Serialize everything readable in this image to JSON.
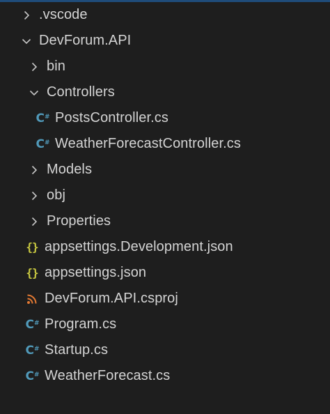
{
  "colors": {
    "background": "#1e1e1e",
    "text": "#d4d4d4",
    "chevron": "#c5c5c5",
    "csharp_icon": "#519aba",
    "json_icon": "#cbcb41",
    "csproj_icon": "#e37933",
    "top_accent": "#1f4c7a"
  },
  "tree": [
    {
      "label": ".vscode",
      "kind": "folder",
      "state": "collapsed",
      "icon": "chevron-right-icon"
    },
    {
      "label": "DevForum.API",
      "kind": "folder",
      "state": "expanded",
      "icon": "chevron-down-icon"
    },
    {
      "label": "bin",
      "kind": "folder",
      "state": "collapsed",
      "icon": "chevron-right-icon"
    },
    {
      "label": "Controllers",
      "kind": "folder",
      "state": "expanded",
      "icon": "chevron-down-icon"
    },
    {
      "label": "PostsController.cs",
      "kind": "file",
      "icon": "csharp-file-icon",
      "icon_text": "C#"
    },
    {
      "label": "WeatherForecastController.cs",
      "kind": "file",
      "icon": "csharp-file-icon",
      "icon_text": "C#"
    },
    {
      "label": "Models",
      "kind": "folder",
      "state": "collapsed",
      "icon": "chevron-right-icon"
    },
    {
      "label": "obj",
      "kind": "folder",
      "state": "collapsed",
      "icon": "chevron-right-icon"
    },
    {
      "label": "Properties",
      "kind": "folder",
      "state": "collapsed",
      "icon": "chevron-right-icon"
    },
    {
      "label": "appsettings.Development.json",
      "kind": "file",
      "icon": "json-file-icon",
      "icon_text": "{}"
    },
    {
      "label": "appsettings.json",
      "kind": "file",
      "icon": "json-file-icon",
      "icon_text": "{}"
    },
    {
      "label": "DevForum.API.csproj",
      "kind": "file",
      "icon": "rss-file-icon"
    },
    {
      "label": "Program.cs",
      "kind": "file",
      "icon": "csharp-file-icon",
      "icon_text": "C#"
    },
    {
      "label": "Startup.cs",
      "kind": "file",
      "icon": "csharp-file-icon",
      "icon_text": "C#"
    },
    {
      "label": "WeatherForecast.cs",
      "kind": "file",
      "icon": "csharp-file-icon",
      "icon_text": "C#"
    }
  ]
}
